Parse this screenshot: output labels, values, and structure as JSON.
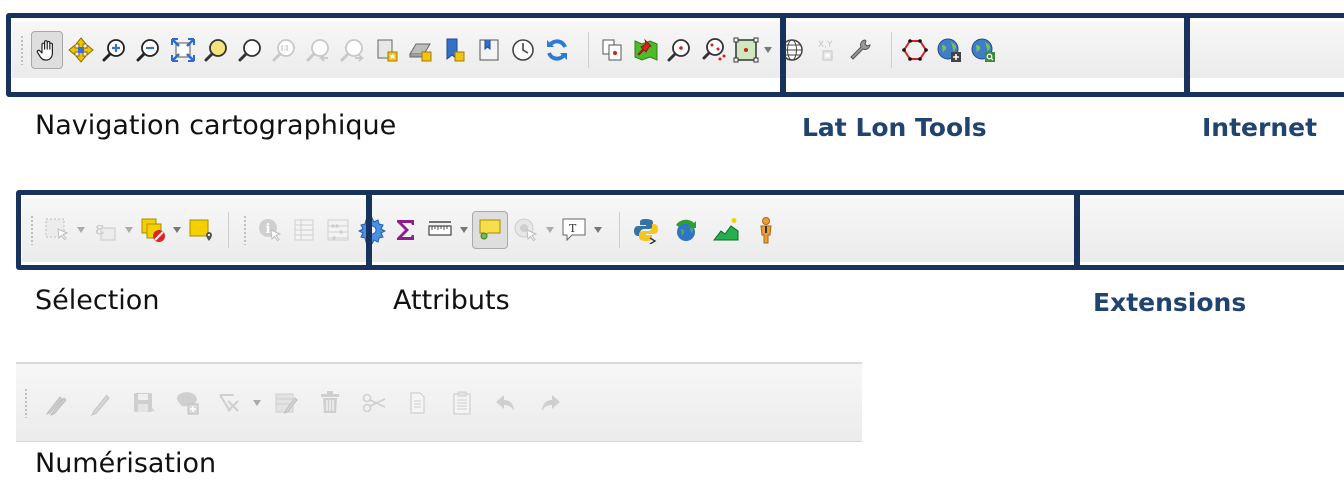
{
  "sections": {
    "navigation": "Navigation cartographique",
    "latlon": "Lat Lon Tools",
    "internet": "Internet",
    "selection": "Sélection",
    "attributs": "Attributs",
    "extensions": "Extensions",
    "numerisation": "Numérisation"
  },
  "colors": {
    "frame": "#17325c",
    "section_title_accent": "#20436f",
    "toolbar_bg": "#efefef",
    "disabled_icon": "#cfcfcf"
  },
  "toolbars": {
    "navigation": [
      "pan-map",
      "pan-to-selection",
      "zoom-in",
      "zoom-out",
      "zoom-full",
      "zoom-to-selection",
      "zoom-to-layer",
      "zoom-native-resolution",
      "zoom-last",
      "zoom-next",
      "new-map-view",
      "new-3d-map-view",
      "new-spatial-bookmark",
      "show-spatial-bookmarks",
      "temporal-controller",
      "refresh"
    ],
    "latlon": [
      "copy-coordinate",
      "zoom-to-coordinate",
      "zoom-to-point",
      "multi-zoom",
      "copy-extent",
      "external-map",
      "xy-conversion",
      "settings"
    ],
    "internet": [
      "polygon-digitize",
      "globe-add",
      "globe-search"
    ],
    "selection": [
      "select-features",
      "select-by-expression",
      "deselect-all",
      "select-by-location"
    ],
    "attributs": [
      "identify-features",
      "open-attribute-table",
      "field-calculator",
      "processing-toolbox",
      "statistics",
      "measure-line",
      "map-tips",
      "actions",
      "text-annotation"
    ],
    "extensions": [
      "python-console",
      "plugin-update",
      "profile-tool",
      "person-plugin"
    ],
    "numerisation": [
      "current-edits",
      "toggle-editing",
      "save-edits",
      "add-feature",
      "vertex-tool",
      "modify-attributes",
      "delete-selected",
      "cut-features",
      "copy-features",
      "paste-features",
      "undo",
      "redo"
    ]
  }
}
